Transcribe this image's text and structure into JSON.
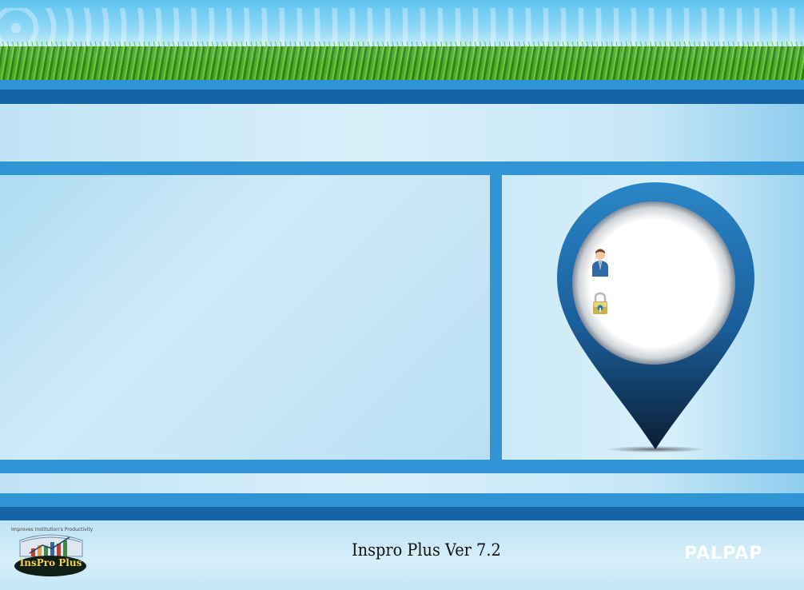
{
  "footer": {
    "version": "Inspro Plus Ver 7.2",
    "brand": "PALPAP",
    "logo_tagline": "Improves Institution's Productivity",
    "logo_name": "InsPro Plus"
  },
  "login": {
    "username_value": "",
    "password_value": ""
  },
  "colors": {
    "stripe_light": "#2f95d4",
    "stripe_dark": "#1564a8",
    "pin_blue": "#1f6fb0",
    "background": "#cfeaf7"
  },
  "icons": {
    "user": "user-icon",
    "password": "lock-icon"
  }
}
